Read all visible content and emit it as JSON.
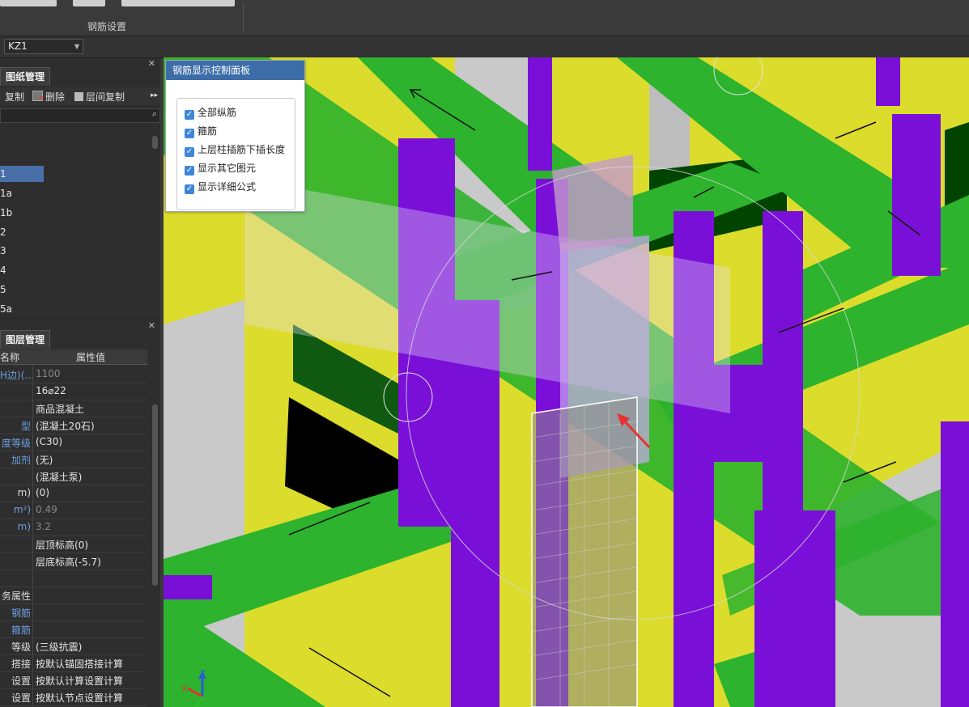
{
  "ribbon": {
    "group_label": "钢筋设置"
  },
  "component_selector": {
    "value": "KZ1"
  },
  "drawing_panel": {
    "tab": "图纸管理",
    "tools": {
      "copy": "复制",
      "delete": "删除",
      "floor_copy": "层间复制"
    },
    "items": [
      "1",
      "1a",
      "1b",
      "2",
      "3",
      "4",
      "5",
      "5a"
    ]
  },
  "layer_panel": {
    "tab": "图层管理",
    "headers": {
      "name": "名称",
      "value": "属性值"
    },
    "rows": [
      {
        "name": "H边)(...",
        "value": "1100",
        "blue": true,
        "dim": true
      },
      {
        "name": "",
        "value": "16⌀22",
        "blue": false,
        "dim": false
      },
      {
        "name": "",
        "value": "商品混凝土",
        "blue": false,
        "dim": false
      },
      {
        "name": "型",
        "value": "(混凝土20石)",
        "blue": true,
        "dim": false
      },
      {
        "name": "度等级",
        "value": "(C30)",
        "blue": true,
        "dim": false
      },
      {
        "name": "加剂",
        "value": "(无)",
        "blue": true,
        "dim": false
      },
      {
        "name": "",
        "value": "(混凝土泵)",
        "blue": false,
        "dim": false
      },
      {
        "name": "m)",
        "value": "(0)",
        "blue": false,
        "dim": false
      },
      {
        "name": "m²)",
        "value": "0.49",
        "blue": true,
        "dim": true
      },
      {
        "name": "m)",
        "value": "3.2",
        "blue": true,
        "dim": true
      },
      {
        "name": "",
        "value": "层顶标高(0)",
        "blue": false,
        "dim": false
      },
      {
        "name": "",
        "value": "层底标高(-5.7)",
        "blue": false,
        "dim": false
      },
      {
        "name": "",
        "value": "",
        "blue": false,
        "dim": false
      },
      {
        "name": "务属性",
        "value": "",
        "blue": false,
        "dim": false
      },
      {
        "name": "钢筋",
        "value": "",
        "blue": true,
        "dim": false
      },
      {
        "name": "箍筋",
        "value": "",
        "blue": true,
        "dim": false
      },
      {
        "name": "等级",
        "value": "(三级抗震)",
        "blue": false,
        "dim": false
      },
      {
        "name": "搭接",
        "value": "按默认锚固搭接计算",
        "blue": false,
        "dim": false
      },
      {
        "name": "设置",
        "value": "按默认计算设置计算",
        "blue": false,
        "dim": false
      },
      {
        "name": "设置",
        "value": "按默认节点设置计算",
        "blue": false,
        "dim": false
      }
    ]
  },
  "control_panel": {
    "title": "钢筋显示控制面板",
    "options": [
      {
        "label": "全部纵筋",
        "checked": true
      },
      {
        "label": "箍筋",
        "checked": true
      },
      {
        "label": "上层柱插筋下插长度",
        "checked": true
      },
      {
        "label": "显示其它图元",
        "checked": true
      },
      {
        "label": "显示详细公式",
        "checked": true
      }
    ]
  },
  "axis": {
    "x": "X",
    "z": "Z"
  },
  "colors": {
    "slab": "#dcdc2c",
    "beam": "#2db32d",
    "column": "#7a10d8",
    "wall": "#c8c8c8",
    "accent": "#3d6da8"
  }
}
